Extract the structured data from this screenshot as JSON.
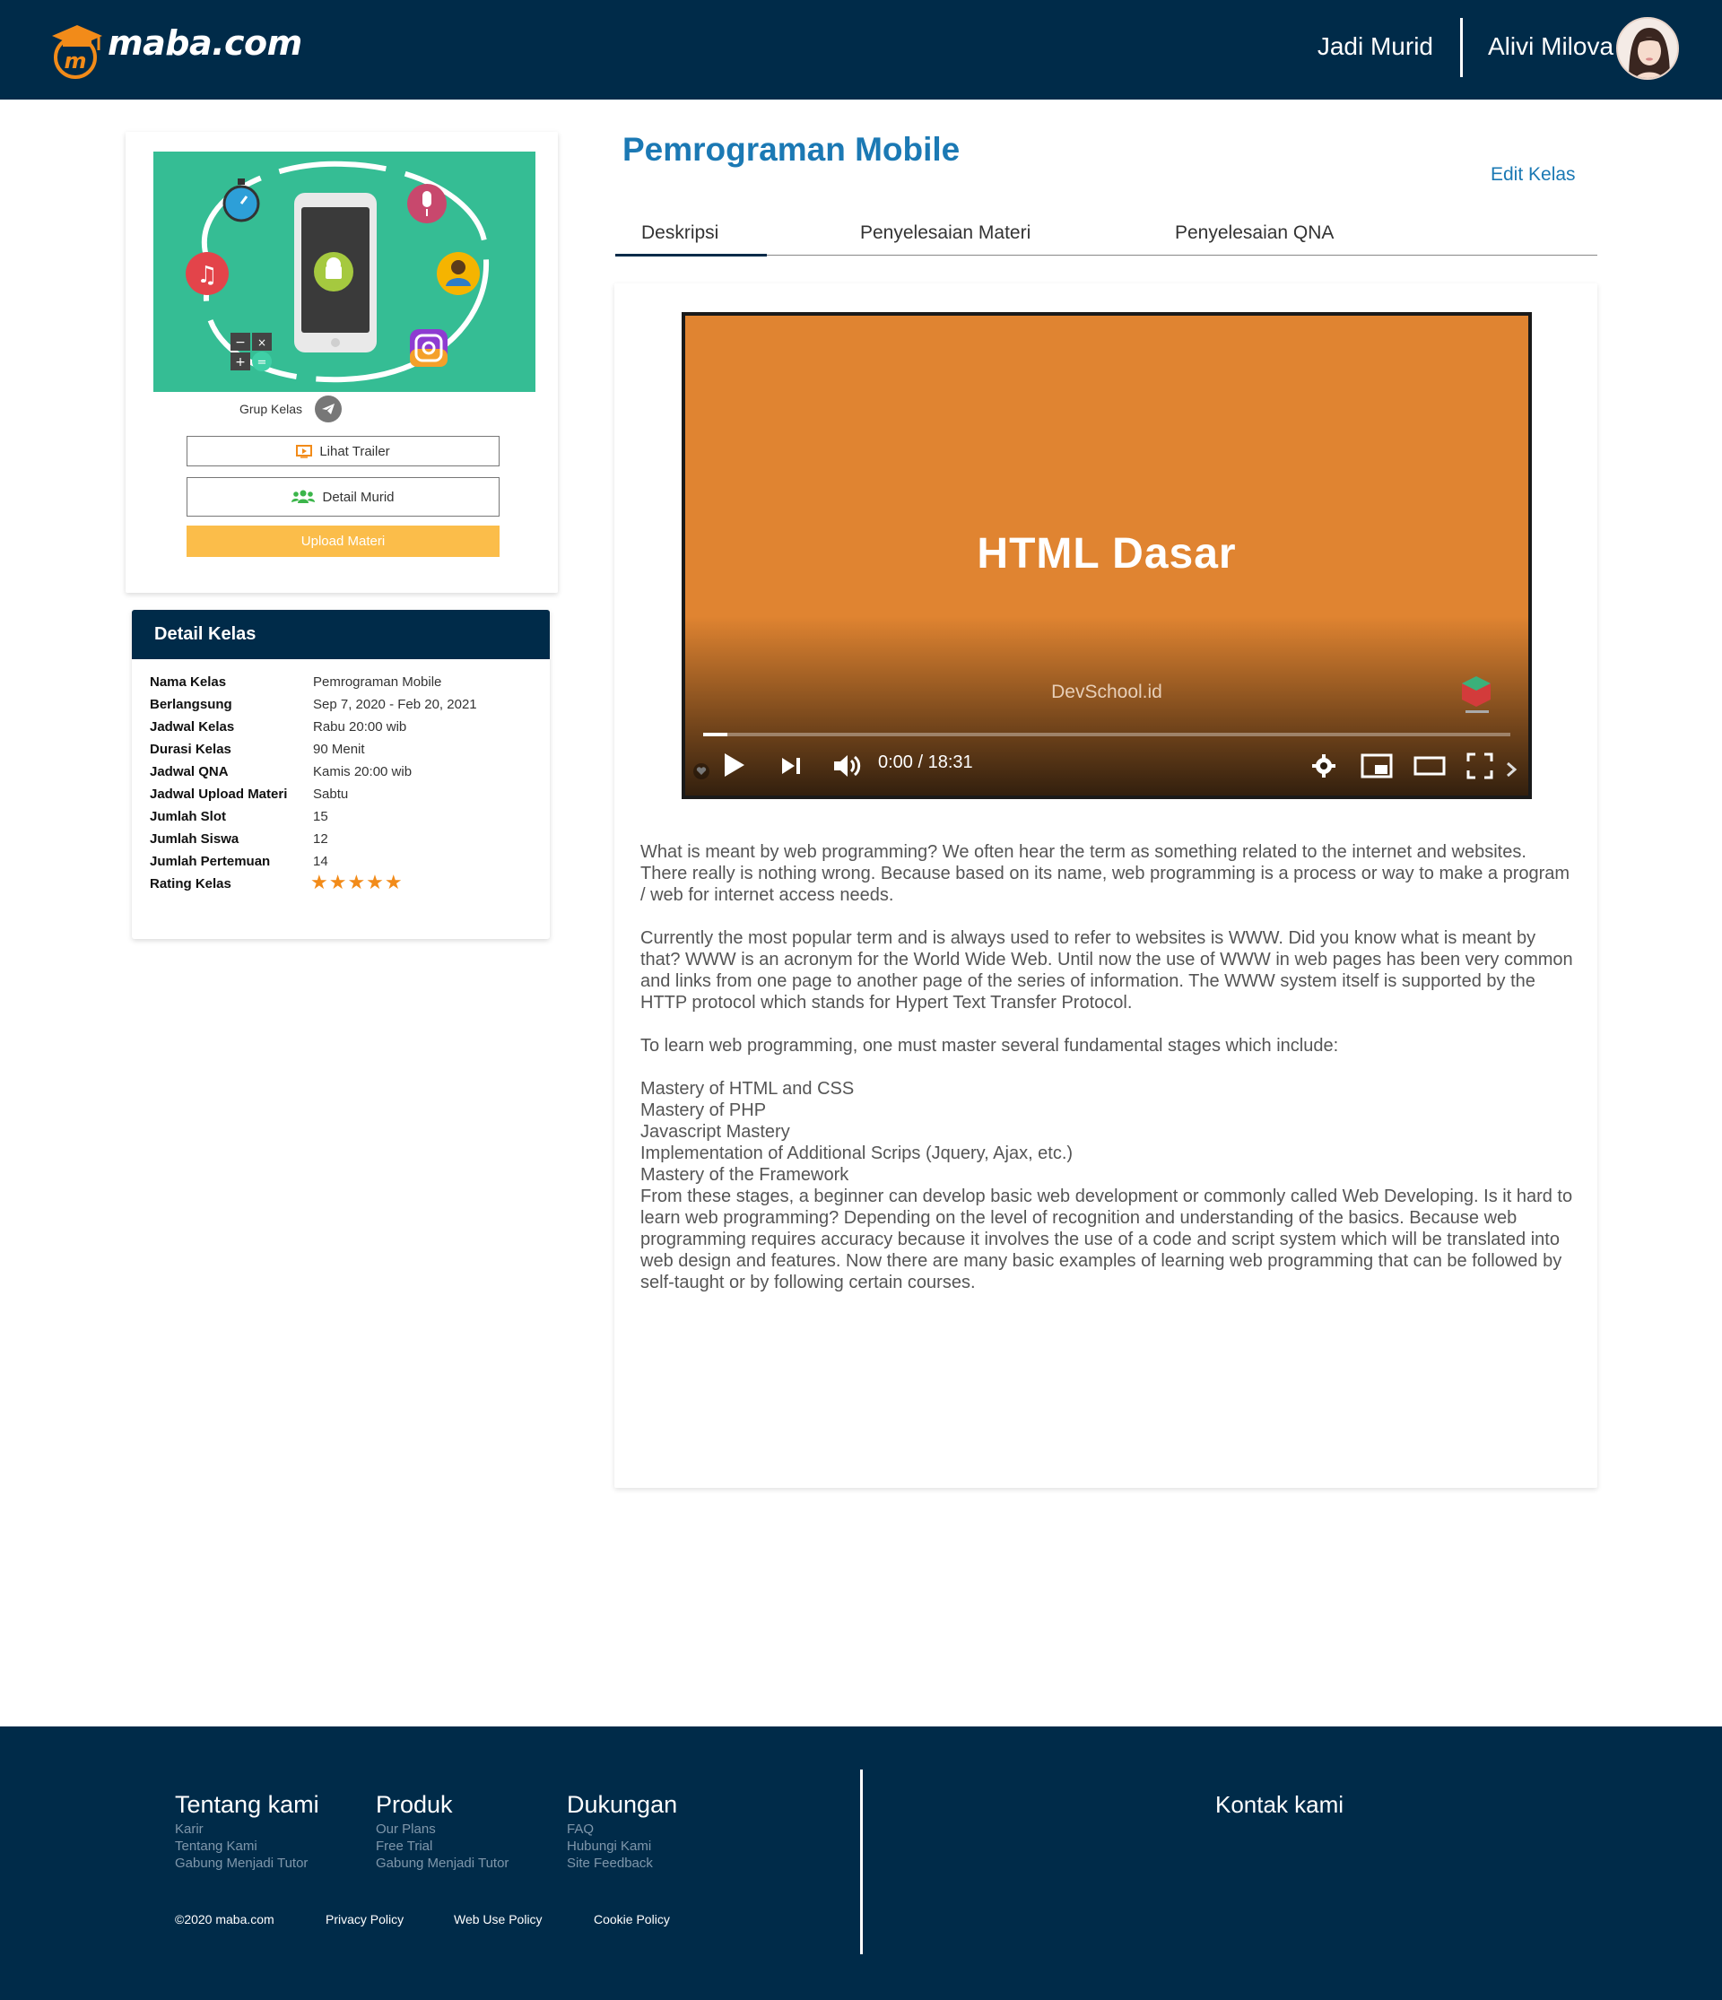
{
  "header": {
    "brand": "maba.com",
    "nav_jadi_murid": "Jadi Murid",
    "user_name": "Alivi Milova"
  },
  "class_card": {
    "grup_kelas": "Grup Kelas",
    "lihat_trailer": "Lihat Trailer",
    "detail_murid": "Detail Murid",
    "upload_materi": "Upload Materi"
  },
  "detail": {
    "title": "Detail Kelas",
    "rows": [
      {
        "key": "Nama Kelas",
        "value": "Pemrograman Mobile"
      },
      {
        "key": "Berlangsung",
        "value": "Sep 7, 2020 - Feb 20, 2021"
      },
      {
        "key": "Jadwal Kelas",
        "value": "Rabu 20:00 wib"
      },
      {
        "key": "Durasi Kelas",
        "value": "90 Menit"
      },
      {
        "key": "Jadwal QNA",
        "value": "Kamis 20:00 wib"
      },
      {
        "key": "Jadwal Upload Materi",
        "value": "Sabtu"
      },
      {
        "key": "Jumlah Slot",
        "value": "15"
      },
      {
        "key": "Jumlah Siswa",
        "value": "12"
      },
      {
        "key": "Jumlah Pertemuan",
        "value": "14"
      },
      {
        "key": "Rating Kelas",
        "value": ""
      }
    ],
    "rating": 5,
    "stars_text": "★★★★★"
  },
  "main": {
    "title": "Pemrograman Mobile",
    "edit_label": "Edit Kelas",
    "tabs": [
      {
        "label": "Deskripsi",
        "active": true
      },
      {
        "label": "Penyelesaian Materi",
        "active": false
      },
      {
        "label": "Penyelesaian QNA",
        "active": false
      }
    ]
  },
  "video": {
    "title": "HTML Dasar",
    "channel": "DevSchool.id",
    "time": "0:00 / 18:31",
    "progress": 0.03
  },
  "description": {
    "p1": "What is meant by web programming? We often hear the term as something related to the internet and websites. There really is nothing wrong. Because based on its name, web programming is a process or way to make a program / web for internet access needs.",
    "p2": "Currently the most popular term and is always used to refer to websites is WWW. Did you know what is meant by that? WWW is an acronym for the World Wide Web. Until now the use of WWW in web pages has been very common and links from one page to another page of the series of information. The WWW system itself is supported by the HTTP protocol which stands for Hypert Text Transfer Protocol.",
    "p3": "To learn web programming, one must master several fundamental stages which include:",
    "list": [
      "Mastery of HTML and CSS",
      "Mastery of PHP",
      "Javascript Mastery",
      "Implementation of Additional Scrips (Jquery, Ajax, etc.)",
      "Mastery of the Framework"
    ],
    "p4": "From these stages, a beginner can develop basic web development or commonly called Web Developing. Is it hard to learn web programming? Depending on the level of recognition and understanding of the basics. Because web programming requires accuracy because it involves the use of a code and script system which will be translated into web design and features. Now there are many basic examples of learning web programming that can be followed by self-taught or by following certain courses."
  },
  "footer": {
    "tentang": {
      "head": "Tentang kami",
      "links": [
        "Karir",
        "Tentang Kami",
        "Gabung Menjadi Tutor"
      ]
    },
    "produk": {
      "head": "Produk",
      "links": [
        "Our Plans",
        "Free Trial",
        "Gabung Menjadi Tutor"
      ]
    },
    "dukungan": {
      "head": "Dukungan",
      "links": [
        "FAQ",
        "Hubungi Kami",
        "Site Feedback"
      ]
    },
    "copyright": "©2020 maba.com",
    "privacy": "Privacy Policy",
    "web_use": "Web Use Policy",
    "cookie": "Cookie Policy",
    "kontak": "Kontak kami"
  },
  "colors": {
    "navy": "#002b49",
    "accent_blue": "#1b79b4",
    "upload_yellow": "#fbbd4a",
    "star_orange": "#f28b19",
    "video_orange": "#e08431",
    "thumb_green": "#35bd94"
  }
}
